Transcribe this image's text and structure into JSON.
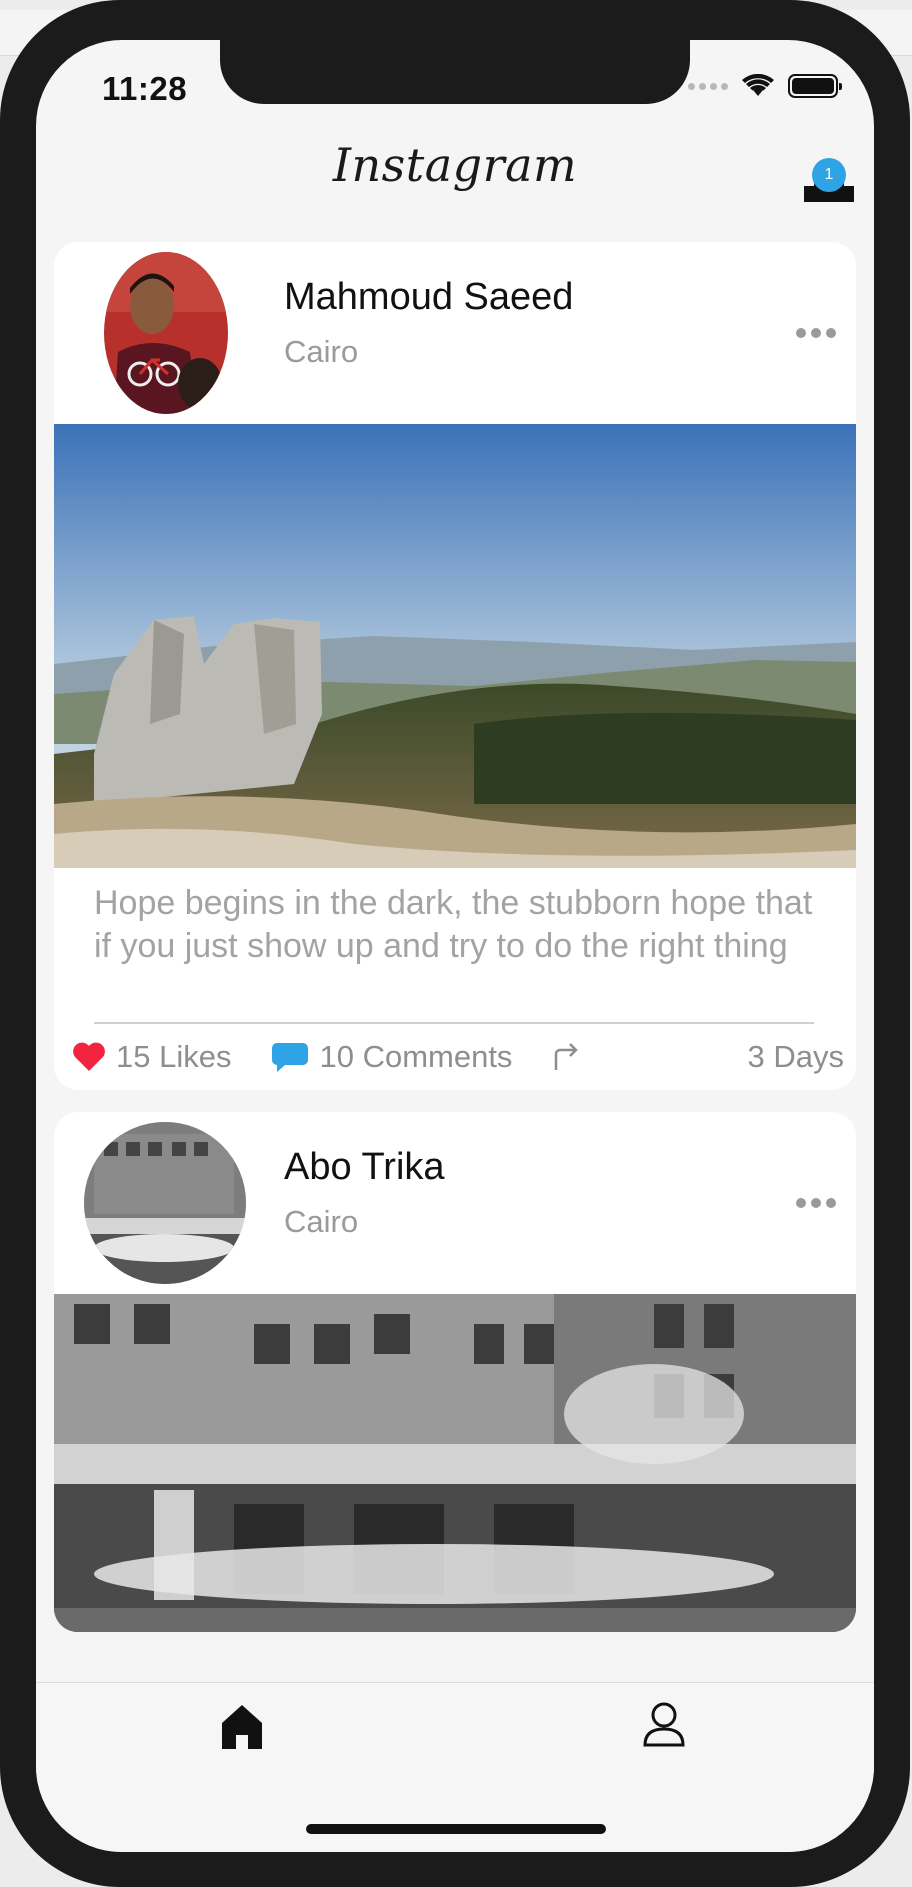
{
  "status": {
    "time": "11:28"
  },
  "header": {
    "logo": "Instagram",
    "notification_count": "1"
  },
  "posts": [
    {
      "user": "Mahmoud Saeed",
      "location": "Cairo",
      "caption": "Hope begins in the dark, the stubborn hope that if you just show up and try to do the right thing",
      "likes": "15 Likes",
      "comments": "10 Comments",
      "age": "3 Days"
    },
    {
      "user": "Abo Trika",
      "location": "Cairo"
    }
  ],
  "tabbar": {
    "items": [
      "home-icon",
      "profile-icon"
    ]
  },
  "colors": {
    "like": "#f2243f",
    "comment": "#2ea4e6",
    "badge": "#2ea4e6"
  }
}
